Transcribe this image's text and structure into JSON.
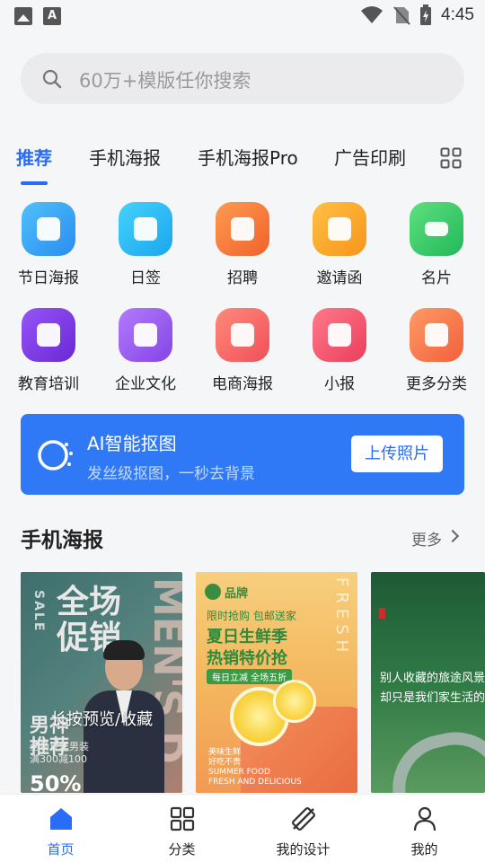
{
  "status_bar": {
    "time": "4:45"
  },
  "search": {
    "placeholder": "60万+模版任你搜索"
  },
  "tabs": [
    {
      "label": "推荐",
      "active": true
    },
    {
      "label": "手机海报"
    },
    {
      "label": "手机海报Pro"
    },
    {
      "label": "广告印刷"
    }
  ],
  "categories": [
    {
      "label": "节日海报",
      "icon": "holiday-poster-icon",
      "color": "#39a5f5"
    },
    {
      "label": "日签",
      "icon": "daily-sign-icon",
      "color": "#26b3f0"
    },
    {
      "label": "招聘",
      "icon": "recruit-icon",
      "color": "#f57a3c"
    },
    {
      "label": "邀请函",
      "icon": "invitation-icon",
      "color": "#f7a72a"
    },
    {
      "label": "名片",
      "icon": "business-card-icon",
      "color": "#36c56a"
    },
    {
      "label": "教育培训",
      "icon": "education-icon",
      "color": "#7a3ce8"
    },
    {
      "label": "企业文化",
      "icon": "enterprise-culture-icon",
      "color": "#9a5af2"
    },
    {
      "label": "电商海报",
      "icon": "ecommerce-poster-icon",
      "color": "#f56a6a"
    },
    {
      "label": "小报",
      "icon": "tabloid-icon",
      "color": "#f4546b"
    },
    {
      "label": "更多分类",
      "icon": "more-categories-icon",
      "color": "#f57a4a"
    }
  ],
  "banner": {
    "title": "AI智能抠图",
    "subtitle": "发丝级抠图，一秒去背景",
    "button": "上传照片"
  },
  "section": {
    "title": "手机海报",
    "more": "更多"
  },
  "posters": {
    "overlay_tip": "长按预览/收藏",
    "p1": {
      "big": "全场\n促销",
      "side": "SALE",
      "mens": "MEN'S D",
      "title2": "男神\n推荐",
      "small": "全场夏季男装\n满300减100",
      "percent": "50%"
    },
    "p2": {
      "brand": "品牌",
      "fresh": "FRESH",
      "line1": "限时抢购 包邮送家",
      "line2": "夏日生鲜季",
      "line3": "热销特价抢",
      "tag": "每日立减  全场五折",
      "small": "美味生鲜\n好吃不贵\nSUMMER FOOD\nFRESH AND DELICIOUS"
    },
    "p3": {
      "text": "别人收藏的旅途风景\n却只是我们家生活的"
    }
  },
  "bottom_nav": [
    {
      "label": "首页",
      "icon": "home-icon",
      "active": true
    },
    {
      "label": "分类",
      "icon": "category-grid-icon"
    },
    {
      "label": "我的设计",
      "icon": "my-design-icon"
    },
    {
      "label": "我的",
      "icon": "profile-icon"
    }
  ],
  "colors": {
    "accent": "#2a6cf5",
    "banner": "#2f79f6"
  }
}
